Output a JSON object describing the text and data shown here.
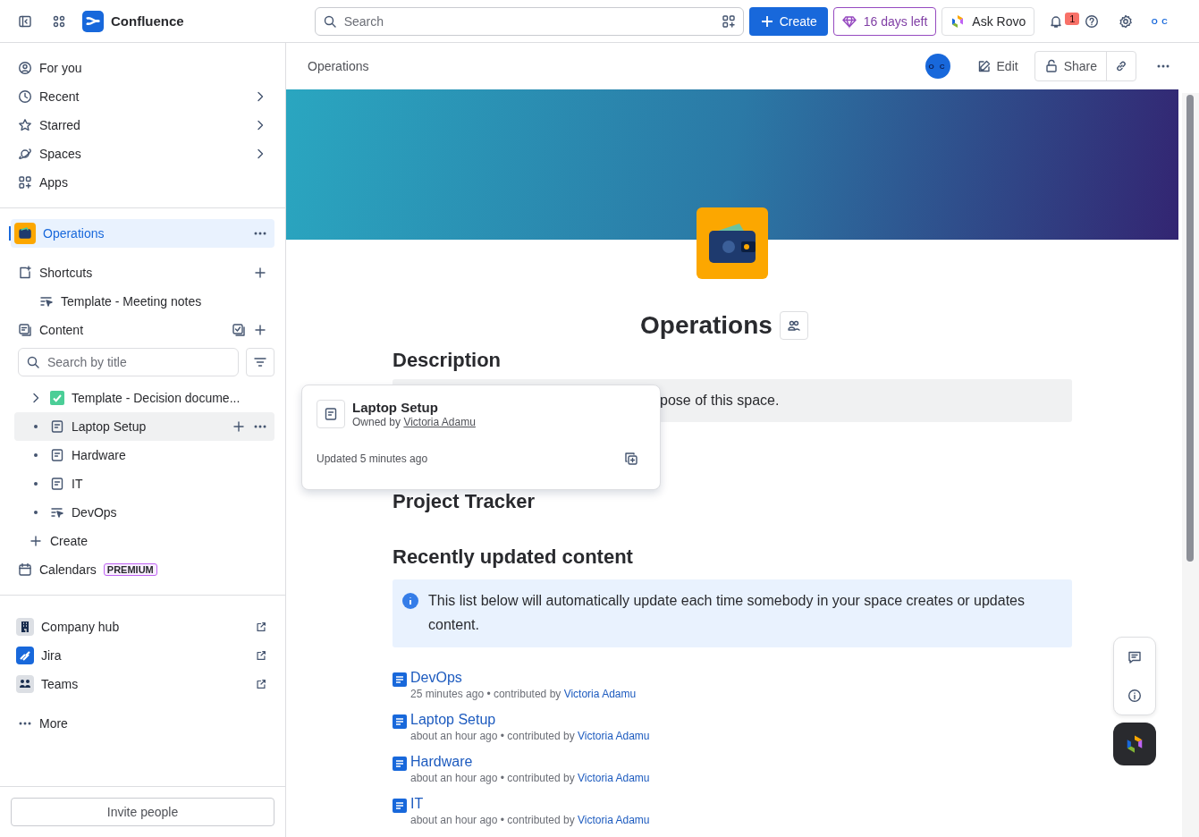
{
  "top_bar": {
    "product": "Confluence",
    "search_placeholder": "Search",
    "create": "Create",
    "trial": "16 days left",
    "ask": "Ask Rovo",
    "notification_count": "1",
    "avatar_initials": "O C"
  },
  "sidebar": {
    "nav": [
      {
        "label": "For you",
        "kind": "person",
        "expandable": false
      },
      {
        "label": "Recent",
        "kind": "clock",
        "expandable": true
      },
      {
        "label": "Starred",
        "kind": "star",
        "expandable": true
      },
      {
        "label": "Spaces",
        "kind": "planet",
        "expandable": true
      },
      {
        "label": "Apps",
        "kind": "apps",
        "expandable": false
      }
    ],
    "space": {
      "name": "Operations",
      "selected": true
    },
    "shortcuts": {
      "label": "Shortcuts",
      "items": [
        {
          "label": "Template - Meeting notes",
          "kind": "live"
        }
      ]
    },
    "content": {
      "label": "Content",
      "search_placeholder": "Search by title",
      "tree": [
        {
          "label": "Template - Decision docume...",
          "kind": "decision",
          "expandable": true,
          "selected": false
        },
        {
          "label": "Laptop Setup",
          "kind": "page",
          "expandable": false,
          "selected": true
        },
        {
          "label": "Hardware",
          "kind": "page",
          "expandable": false,
          "selected": false
        },
        {
          "label": "IT",
          "kind": "page",
          "expandable": false,
          "selected": false
        },
        {
          "label": "DevOps",
          "kind": "live",
          "expandable": false,
          "selected": false
        }
      ],
      "create": "Create"
    },
    "calendars": {
      "label": "Calendars",
      "badge": "PREMIUM"
    },
    "apps": [
      {
        "label": "Company hub",
        "kind": "hub"
      },
      {
        "label": "Jira",
        "kind": "jira"
      },
      {
        "label": "Teams",
        "kind": "teams"
      }
    ],
    "more": "More",
    "invite": "Invite people"
  },
  "page": {
    "breadcrumb": "Operations",
    "avatar_initials": "O C",
    "edit": "Edit",
    "share": "Share",
    "title": "Operations",
    "description_heading": "Description",
    "description_text": "pose of this space.",
    "project_heading": "Project Tracker",
    "recent_heading": "Recently updated content",
    "info": "This list below will automatically update each time somebody in your space creates or updates content.",
    "recent": [
      {
        "title": "DevOps",
        "meta": "25 minutes ago • contributed by",
        "author": "Victoria Adamu"
      },
      {
        "title": "Laptop Setup",
        "meta": "about an hour ago • contributed by",
        "author": "Victoria Adamu"
      },
      {
        "title": "Hardware",
        "meta": "about an hour ago • contributed by",
        "author": "Victoria Adamu"
      },
      {
        "title": "IT",
        "meta": "about an hour ago • contributed by",
        "author": "Victoria Adamu"
      }
    ]
  },
  "hover_card": {
    "title": "Laptop Setup",
    "owner_prefix": "Owned by",
    "owner": "Victoria Adamu",
    "updated": "Updated 5 minutes ago"
  }
}
